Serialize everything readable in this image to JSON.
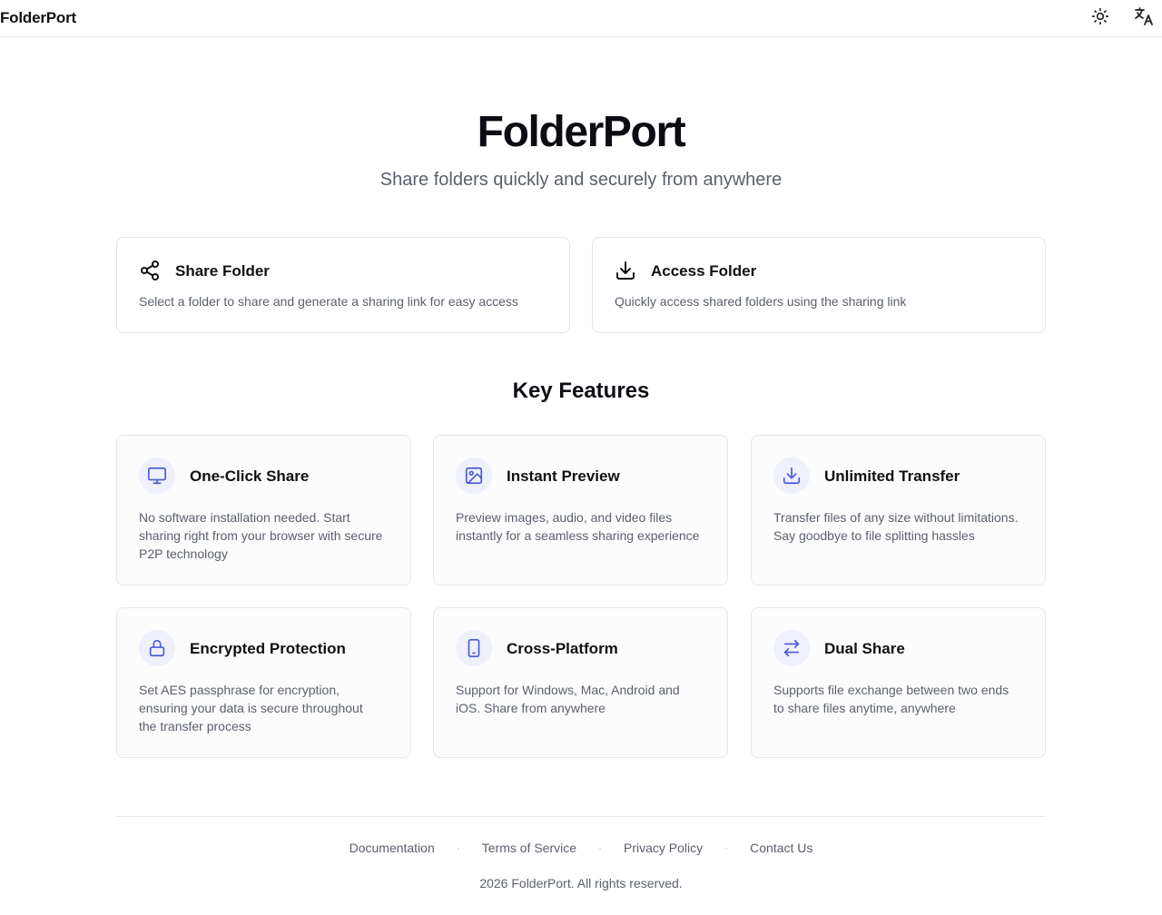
{
  "header": {
    "brand": "FolderPort",
    "theme_icon": "sun-icon",
    "language_icon": "translate-icon"
  },
  "hero": {
    "title": "FolderPort",
    "subtitle": "Share folders quickly and securely from anywhere"
  },
  "actions": [
    {
      "icon": "share-icon",
      "title": "Share Folder",
      "description": "Select a folder to share and generate a sharing link for easy access"
    },
    {
      "icon": "download-icon",
      "title": "Access Folder",
      "description": "Quickly access shared folders using the sharing link"
    }
  ],
  "features": {
    "title": "Key Features",
    "items": [
      {
        "icon": "monitor-icon",
        "title": "One-Click Share",
        "description": "No software installation needed. Start sharing right from your browser with secure P2P technology"
      },
      {
        "icon": "image-icon",
        "title": "Instant Preview",
        "description": "Preview images, audio, and video files instantly for a seamless sharing experience"
      },
      {
        "icon": "download-icon",
        "title": "Unlimited Transfer",
        "description": "Transfer files of any size without limitations. Say goodbye to file splitting hassles"
      },
      {
        "icon": "lock-icon",
        "title": "Encrypted Protection",
        "description": "Set AES passphrase for encryption, ensuring your data is secure throughout the transfer process"
      },
      {
        "icon": "tablet-icon",
        "title": "Cross-Platform",
        "description": "Support for Windows, Mac, Android and iOS. Share from anywhere"
      },
      {
        "icon": "swap-arrows-icon",
        "title": "Dual Share",
        "description": "Supports file exchange between two ends to share files anytime, anywhere"
      }
    ]
  },
  "footer": {
    "links": [
      "Documentation",
      "Terms of Service",
      "Privacy Policy",
      "Contact Us"
    ],
    "separator": "·",
    "copyright": "2026 FolderPort. All rights reserved."
  },
  "colors": {
    "accent": "#4a5bd4",
    "icon_bg": "#eef0fb",
    "text_muted": "#5b606b",
    "border": "#e3e4e8"
  }
}
